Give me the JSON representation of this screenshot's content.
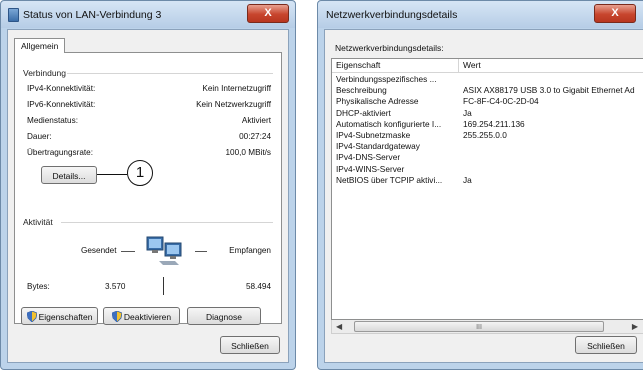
{
  "left_window": {
    "title": "Status von LAN-Verbindung 3",
    "close_label": "X",
    "tab": "Allgemein",
    "group_connection": "Verbindung",
    "rows": [
      {
        "label": "IPv4-Konnektivität:",
        "value": "Kein Internetzugriff"
      },
      {
        "label": "IPv6-Konnektivität:",
        "value": "Kein Netzwerkzugriff"
      },
      {
        "label": "Medienstatus:",
        "value": "Aktiviert"
      },
      {
        "label": "Dauer:",
        "value": "00:27:24"
      },
      {
        "label": "Übertragungsrate:",
        "value": "100,0 MBit/s"
      }
    ],
    "details_button": "Details...",
    "callout_number": "1",
    "group_activity": "Aktivität",
    "sent_label": "Gesendet",
    "received_label": "Empfangen",
    "bytes_label": "Bytes:",
    "bytes_sent": "3.570",
    "bytes_received": "58.494",
    "buttons": {
      "properties": "Eigenschaften",
      "deactivate": "Deaktivieren",
      "diagnose": "Diagnose"
    },
    "close_button": "Schließen"
  },
  "right_window": {
    "title": "Netzwerkverbindungsdetails",
    "close_label": "X",
    "heading": "Netzwerkverbindungsdetails:",
    "columns": [
      "Eigenschaft",
      "Wert"
    ],
    "rows": [
      {
        "property": "Verbindungsspezifisches ...",
        "value": ""
      },
      {
        "property": "Beschreibung",
        "value": "ASIX AX88179 USB 3.0 to Gigabit Ethernet Ad"
      },
      {
        "property": "Physikalische Adresse",
        "value": "FC-8F-C4-0C-2D-04"
      },
      {
        "property": "DHCP-aktiviert",
        "value": "Ja"
      },
      {
        "property": "Automatisch konfigurierte I...",
        "value": "169.254.211.136"
      },
      {
        "property": "IPv4-Subnetzmaske",
        "value": "255.255.0.0"
      },
      {
        "property": "IPv4-Standardgateway",
        "value": ""
      },
      {
        "property": "IPv4-DNS-Server",
        "value": ""
      },
      {
        "property": "IPv4-WINS-Server",
        "value": ""
      },
      {
        "property": "NetBIOS über TCPIP aktivi...",
        "value": "Ja"
      }
    ],
    "scroll_thumb_label": "III",
    "close_button": "Schließen"
  },
  "colors": {
    "frame": "#bcd3ea",
    "close_red": "#c7452d",
    "accent_blue": "#4a7fb5"
  }
}
